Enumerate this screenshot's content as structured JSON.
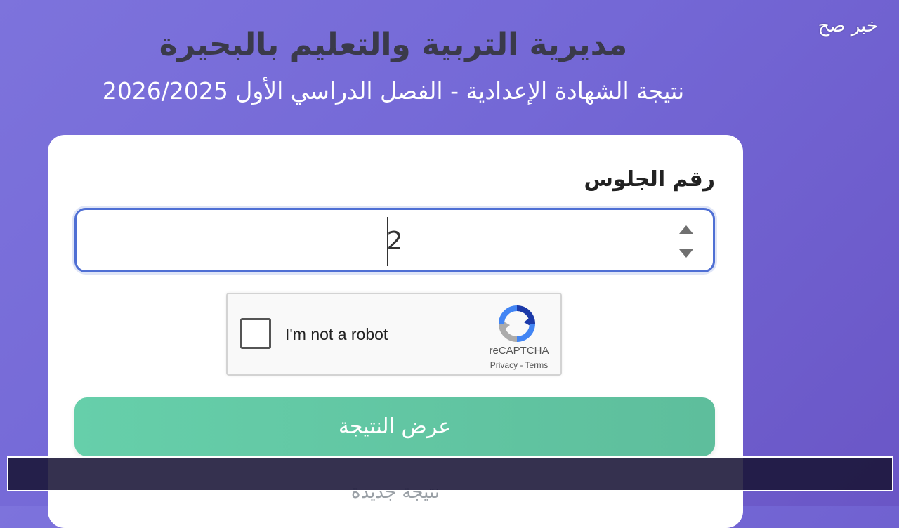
{
  "watermark": "خبر صح",
  "header": {
    "title": "مديرية التربية والتعليم بالبحيرة",
    "subtitle": "نتيجة الشهادة الإعدادية - الفصل الدراسي الأول 2026/2025"
  },
  "form": {
    "seat_label": "رقم الجلوس",
    "seat_value": "2",
    "captcha": {
      "label": "I'm not a robot",
      "brand": "reCAPTCHA",
      "links": "Privacy - Terms"
    },
    "submit_label": "عرض النتيجة",
    "below_text": "نتيجة جديدة"
  },
  "colors": {
    "background": "#7468d6",
    "input_border": "#4f6fd4",
    "submit_button": "#62c7a3",
    "title_text": "#3a3a4a"
  },
  "icons": {
    "spinner_up": "triangle-up",
    "spinner_down": "triangle-down",
    "recaptcha": "recaptcha-logo"
  }
}
